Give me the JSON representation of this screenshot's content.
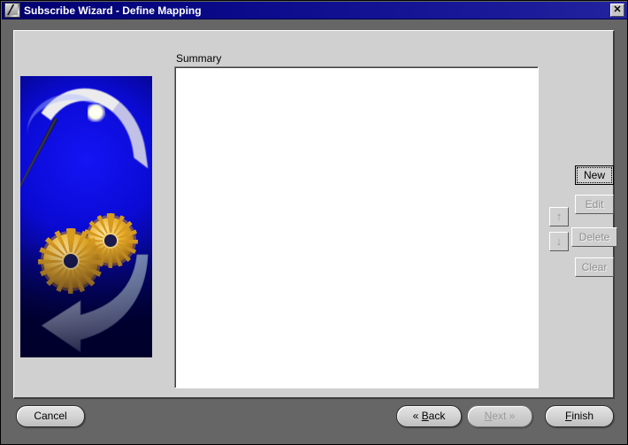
{
  "window": {
    "title": "Subscribe Wizard  - Define Mapping",
    "icon": "wizard-document-icon",
    "close_label": "✕",
    "background_color": "#666666",
    "panel_color": "#d0d0d0",
    "titlebar_color": "#00006e"
  },
  "illustration": {
    "name": "wizard-wand-gears-arrow-graphic",
    "background_color": "#0a0ad4",
    "gear_color": "#e8b02e",
    "arrow_color": "#c9d2e8"
  },
  "summary": {
    "label": "Summary",
    "items": [],
    "empty_text": ""
  },
  "side_actions": [
    {
      "id": "new",
      "label": "New",
      "enabled": true,
      "focused": true
    },
    {
      "id": "edit",
      "label": "Edit",
      "enabled": false,
      "focused": false
    },
    {
      "id": "delete",
      "label": "Delete",
      "enabled": false,
      "focused": false
    },
    {
      "id": "clear",
      "label": "Clear",
      "enabled": false,
      "focused": false
    }
  ],
  "order_actions": [
    {
      "id": "move-up",
      "label": "↑",
      "icon": "arrow-up-icon",
      "enabled": false
    },
    {
      "id": "move-down",
      "label": "↓",
      "icon": "arrow-down-icon",
      "enabled": false
    }
  ],
  "navigation": {
    "cancel": {
      "label": "Cancel",
      "enabled": true
    },
    "back": {
      "chevron": "«",
      "mnemonic": "B",
      "rest": "ack",
      "label": "« Back",
      "enabled": true
    },
    "next": {
      "chevron": "»",
      "mnemonic": "N",
      "rest": "ext",
      "label": "Next »",
      "enabled": false
    },
    "finish": {
      "mnemonic": "F",
      "rest": "inish",
      "label": "Finish",
      "enabled": true
    }
  }
}
